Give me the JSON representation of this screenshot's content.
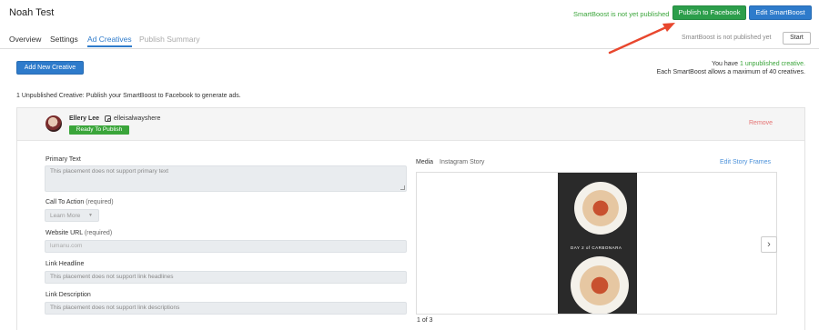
{
  "app": {
    "title": "Noah Test",
    "status_text": "SmartBoost is not yet published",
    "publish_label": "Publish to Facebook",
    "edit_label": "Edit SmartBoost"
  },
  "tabs": {
    "items": [
      {
        "label": "Overview"
      },
      {
        "label": "Settings"
      },
      {
        "label": "Ad Creatives"
      },
      {
        "label": "Publish Summary"
      }
    ],
    "status_text": "SmartBoost is not published yet",
    "start_label": "Start"
  },
  "creatives": {
    "add_label": "Add New Creative",
    "info_prefix": "You have",
    "info_link": "1 unpublished creative.",
    "info_max": "Each SmartBoost allows a maximum of 40 creatives.",
    "unpublished_count": "1 Unpublished Creative:",
    "unpublished_hint": "Publish your SmartBoost to Facebook to generate ads."
  },
  "card": {
    "author_name": "Ellery Lee",
    "handle": "elleisalwayshere",
    "badge": "Ready To Publish",
    "remove_label": "Remove",
    "primary_text": {
      "label": "Primary Text",
      "value": "This placement does not support primary text"
    },
    "cta": {
      "label": "Call To Action",
      "required": "(required)",
      "value": "Learn More"
    },
    "website_url": {
      "label": "Website URL",
      "required": "(required)",
      "placeholder": "lumanu.com"
    },
    "link_headline": {
      "label": "Link Headline",
      "value": "This placement does not support link headlines"
    },
    "link_description": {
      "label": "Link Description",
      "value": "This placement does not support link descriptions"
    },
    "media": {
      "tab_media": "Media",
      "tab_story": "Instagram Story",
      "edit_frames": "Edit Story Frames",
      "story_caption": "DAY 2 of CARBONARA",
      "next": "›",
      "pager": "1 of 3"
    }
  },
  "colors": {
    "publish_green": "#2c9e4b",
    "primary_blue": "#2e7bcb",
    "ready_green": "#3aa53a",
    "remove_red": "#e57373",
    "annotation_arrow": "#e8472e"
  },
  "icons": [
    "instagram-icon",
    "chevron-right-icon",
    "caret-down-icon",
    "annotation-arrow"
  ]
}
